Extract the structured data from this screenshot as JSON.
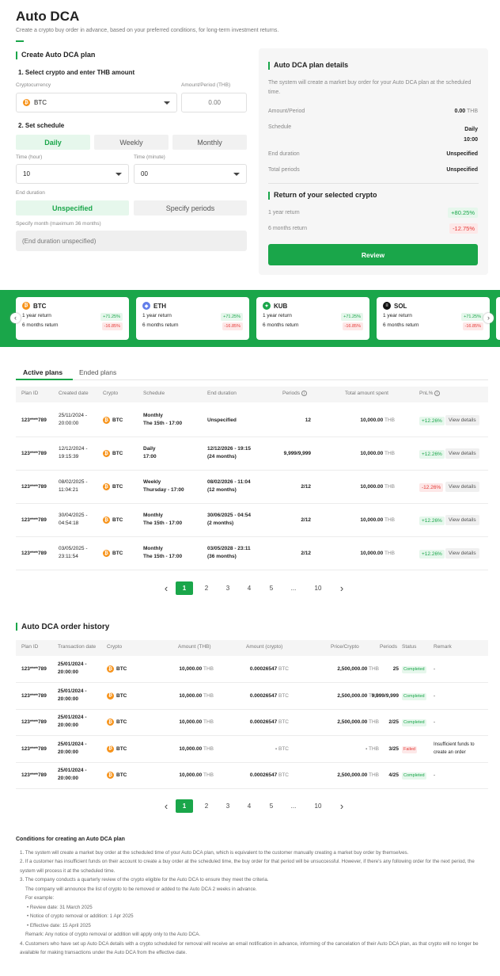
{
  "header": {
    "title": "Auto DCA",
    "subtitle": "Create a crypto buy order in advance, based on your preferred conditions, for long-term investment returns."
  },
  "create_plan": {
    "title": "Create Auto DCA plan",
    "step1": "1. Select crypto and enter THB amount",
    "crypto_label": "Cryptocurrency",
    "crypto_value": "BTC",
    "amount_label": "Amount/Period (THB)",
    "amount_placeholder": "0.00",
    "step2": "2. Set schedule",
    "freq_tabs": [
      "Daily",
      "Weekly",
      "Monthly"
    ],
    "hour_label": "Time (hour)",
    "hour_value": "10",
    "minute_label": "Time (minute)",
    "minute_value": "00",
    "end_label": "End duration",
    "end_tabs": [
      "Unspecified",
      "Specify periods"
    ],
    "month_label": "Specify month (maximum 36 months)",
    "month_placeholder": "(End duration unspecified)"
  },
  "details": {
    "title": "Auto DCA plan details",
    "desc": "The system will create a market buy order for your Auto DCA plan at the scheduled time.",
    "amount_label": "Amount/Period",
    "amount_value": "0.00",
    "amount_unit": "THB",
    "schedule_label": "Schedule",
    "schedule_value1": "Daily",
    "schedule_value2": "10:00",
    "end_label": "End duration",
    "end_value": "Unspecified",
    "periods_label": "Total periods",
    "periods_value": "Unspecified",
    "return_title": "Return of your selected crypto",
    "y1_label": "1 year return",
    "y1_value": "+80.25%",
    "m6_label": "6 months return",
    "m6_value": "-12.75%",
    "review": "Review"
  },
  "coins": [
    {
      "name": "BTC",
      "glyph": "₿",
      "color": "#f7931a",
      "y1_label": "1 year return",
      "y1": "+71.25%",
      "m6_label": "6 months return",
      "m6": "-16.85%"
    },
    {
      "name": "ETH",
      "glyph": "◆",
      "color": "#627eea",
      "y1_label": "1 year return",
      "y1": "+71.25%",
      "m6_label": "6 months return",
      "m6": "-16.85%"
    },
    {
      "name": "KUB",
      "glyph": "✦",
      "color": "#1aa64a",
      "y1_label": "1 year return",
      "y1": "+71.25%",
      "m6_label": "6 months return",
      "m6": "-16.85%"
    },
    {
      "name": "SOL",
      "glyph": "≡",
      "color": "#111111",
      "y1_label": "1 year return",
      "y1": "+71.25%",
      "m6_label": "6 months return",
      "m6": "-16.85%"
    }
  ],
  "plans": {
    "tabs": [
      "Active plans",
      "Ended plans"
    ],
    "headers": [
      "Plan ID",
      "Created date",
      "Crypto",
      "Schedule",
      "End duration",
      "Periods",
      "Total amount spent",
      "PnL%"
    ],
    "view_label": "View details",
    "thb": "THB",
    "rows": [
      {
        "id": "123****789",
        "date1": "25/11/2024 -",
        "date2": "20:00:00",
        "crypto": "BTC",
        "sch1": "Monthly",
        "sch2": "The 15th - 17:00",
        "end1": "Unspecified",
        "end2": "",
        "periods": "12",
        "amount": "10,000.00",
        "pnl": "+12.26%",
        "pnl_type": "pos"
      },
      {
        "id": "123****789",
        "date1": "12/12/2024 -",
        "date2": "19:15:39",
        "crypto": "BTC",
        "sch1": "Daily",
        "sch2": "17:00",
        "end1": "12/12/2026 - 19:15",
        "end2": "(24 months)",
        "periods": "9,999/9,999",
        "amount": "10,000.00",
        "pnl": "+12.26%",
        "pnl_type": "pos"
      },
      {
        "id": "123****789",
        "date1": "08/02/2025 -",
        "date2": "11:04:21",
        "crypto": "BTC",
        "sch1": "Weekly",
        "sch2": "Thursday - 17:00",
        "end1": "08/02/2026 - 11:04",
        "end2": "(12 months)",
        "periods": "2/12",
        "amount": "10,000.00",
        "pnl": "-12.26%",
        "pnl_type": "neg"
      },
      {
        "id": "123****789",
        "date1": "30/04/2025 -",
        "date2": "04:54:18",
        "crypto": "BTC",
        "sch1": "Monthly",
        "sch2": "The 15th - 17:00",
        "end1": "30/06/2025 - 04:54",
        "end2": "(2 months)",
        "periods": "2/12",
        "amount": "10,000.00",
        "pnl": "+12.26%",
        "pnl_type": "pos"
      },
      {
        "id": "123****789",
        "date1": "03/05/2025 -",
        "date2": "23:11:54",
        "crypto": "BTC",
        "sch1": "Monthly",
        "sch2": "The 15th - 17:00",
        "end1": "03/05/2028 - 23:11",
        "end2": "(36 months)",
        "periods": "2/12",
        "amount": "10,000.00",
        "pnl": "+12.26%",
        "pnl_type": "pos"
      }
    ]
  },
  "pagination": {
    "prev": "‹",
    "next": "›",
    "pages": [
      "1",
      "2",
      "3",
      "4",
      "5",
      "...",
      "10"
    ]
  },
  "history": {
    "title": "Auto DCA order history",
    "headers": [
      "Plan ID",
      "Transaction date",
      "Crypto",
      "Amount (THB)",
      "Amount (crypto)",
      "Price/Crypto",
      "Periods",
      "Status",
      "Remark"
    ],
    "rows": [
      {
        "id": "123****789",
        "date1": "25/01/2024 -",
        "date2": "20:00:00",
        "crypto": "BTC",
        "amt": "10,000.00",
        "amt_unit": "THB",
        "camt": "0.00026547",
        "camt_unit": "BTC",
        "price": "2,500,000.00",
        "price_unit": "THB",
        "periods": "25",
        "status": "Completed",
        "status_type": "pos",
        "remark1": "-",
        "remark2": ""
      },
      {
        "id": "123****789",
        "date1": "25/01/2024 -",
        "date2": "20:00:00",
        "crypto": "BTC",
        "amt": "10,000.00",
        "amt_unit": "THB",
        "camt": "0.00026547",
        "camt_unit": "BTC",
        "price": "2,500,000.00",
        "price_unit": "THB",
        "periods": "9,999/9,999",
        "status": "Completed",
        "status_type": "pos",
        "remark1": "-",
        "remark2": ""
      },
      {
        "id": "123****789",
        "date1": "25/01/2024 -",
        "date2": "20:00:00",
        "crypto": "BTC",
        "amt": "10,000.00",
        "amt_unit": "THB",
        "camt": "0.00026547",
        "camt_unit": "BTC",
        "price": "2,500,000.00",
        "price_unit": "THB",
        "periods": "2/25",
        "status": "Completed",
        "status_type": "pos",
        "remark1": "-",
        "remark2": ""
      },
      {
        "id": "123****789",
        "date1": "25/01/2024 -",
        "date2": "20:00:00",
        "crypto": "BTC",
        "amt": "10,000.00",
        "amt_unit": "THB",
        "camt": "-",
        "camt_unit": "BTC",
        "price": "-",
        "price_unit": "THB",
        "periods": "3/25",
        "status": "Failed",
        "status_type": "neg",
        "remark1": "Insufficient funds to",
        "remark2": "create an order"
      },
      {
        "id": "123****789",
        "date1": "25/01/2024 -",
        "date2": "20:00:00",
        "crypto": "BTC",
        "amt": "10,000.00",
        "amt_unit": "THB",
        "camt": "0.00026547",
        "camt_unit": "BTC",
        "price": "2,500,000.00",
        "price_unit": "THB",
        "periods": "4/25",
        "status": "Completed",
        "status_type": "pos",
        "remark1": "-",
        "remark2": ""
      }
    ]
  },
  "conditions": {
    "title": "Conditions for creating an Auto DCA plan",
    "p1": "1. The system will create a market buy order at the scheduled time of your Auto DCA plan, which is equivalent to the customer manually creating a market buy order by themselves.",
    "p2": "2. If a customer has insufficient funds on their account to create a buy order at the scheduled time, the buy order for that period will be unsuccessful. However, if there's any following order for the next period, the system will process it at the scheduled time.",
    "p3": "3. The company conducts a quarterly review of the crypto eligible for the Auto DCA to ensure they meet the criteria.",
    "p3b": "The company will announce the list of crypto to be removed or added to the Auto DCA 2 weeks in advance.",
    "example": "For example:",
    "b1": "Review date: 31 March 2025",
    "b2": "Notice of crypto removal or addition: 1 Apr 2025",
    "b3": "Effective date: 15 April 2025",
    "remark": "Remark: Any notice of crypto removal or addition will apply only to the Auto DCA.",
    "p4": "4. Customers who have set up Auto DCA details with a crypto scheduled for removal will receive an email notification in advance, informing of the cancelation of their Auto DCA plan, as that crypto will no longer be available for making transactions under the Auto DCA from the effective date."
  }
}
